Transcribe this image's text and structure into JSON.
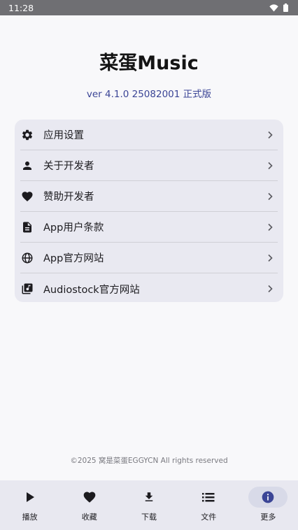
{
  "status_bar": {
    "time": "11:28"
  },
  "app": {
    "title": "菜蛋Music",
    "version": "ver 4.1.0 25082001 正式版"
  },
  "menu": {
    "items": [
      {
        "label": "应用设置",
        "icon": "gear-icon"
      },
      {
        "label": "关于开发者",
        "icon": "person-icon"
      },
      {
        "label": "赞助开发者",
        "icon": "heart-icon"
      },
      {
        "label": "App用户条款",
        "icon": "document-icon"
      },
      {
        "label": "App官方网站",
        "icon": "globe-icon"
      },
      {
        "label": "Audiostock官方网站",
        "icon": "music-library-icon"
      }
    ]
  },
  "footer": {
    "copyright": "©2025 窝是菜蛋EGGYCN All rights reserved"
  },
  "bottom_nav": {
    "items": [
      {
        "label": "播放",
        "icon": "play-icon"
      },
      {
        "label": "收藏",
        "icon": "heart-icon"
      },
      {
        "label": "下载",
        "icon": "download-icon"
      },
      {
        "label": "文件",
        "icon": "list-icon"
      },
      {
        "label": "更多",
        "icon": "info-icon"
      }
    ],
    "active": "更多"
  },
  "colors": {
    "accent": "#3b4596",
    "card_bg": "#e9e9f1",
    "nav_bg": "#e8e8f0",
    "status_bar_bg": "#6f6f73"
  }
}
